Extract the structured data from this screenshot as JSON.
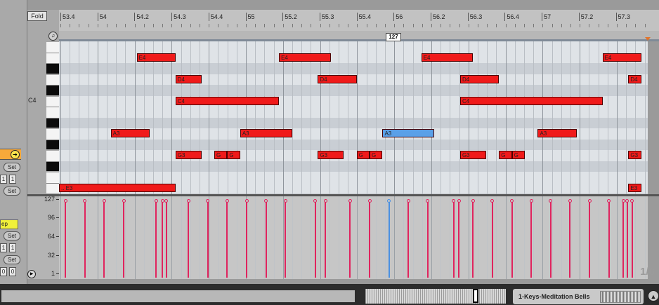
{
  "app": {
    "fold_label": "Fold",
    "key_label": "C4",
    "velocity_badge": "127",
    "zoom": "1/8"
  },
  "left_panel": {
    "set_label": "Set",
    "num_values": [
      "1",
      "1",
      "1",
      "1",
      "0",
      "0"
    ],
    "tag_label": "ep"
  },
  "ruler": {
    "labels": [
      "53.4",
      "54",
      "54.2",
      "54.3",
      "54.4",
      "55",
      "55.2",
      "55.3",
      "55.4",
      "56",
      "56.2",
      "56.3",
      "56.4",
      "57",
      "57.2",
      "57.3"
    ]
  },
  "grid": {
    "lanes_top": [
      "white",
      "white",
      "black",
      "white",
      "black",
      "white",
      "white",
      "black",
      "white",
      "black",
      "white",
      "black",
      "white",
      "white"
    ]
  },
  "notes": [
    {
      "pitch": "E4",
      "row": 1,
      "start": 53.6,
      "end": 53.9,
      "color": "#f01a1a",
      "label": "E4"
    },
    {
      "pitch": "D4",
      "row": 3,
      "start": 53.9,
      "end": 54.1,
      "color": "#f01a1a",
      "label": "D4"
    },
    {
      "pitch": "C4",
      "row": 5,
      "start": 53.9,
      "end": 54.7,
      "color": "#f01a1a",
      "label": "C4"
    },
    {
      "pitch": "A3",
      "row": 8,
      "start": 53.4,
      "end": 53.7,
      "color": "#f01a1a",
      "label": "A3"
    },
    {
      "pitch": "G3",
      "row": 10,
      "start": 53.9,
      "end": 54.1,
      "color": "#f01a1a",
      "label": "G3"
    },
    {
      "pitch": "G3b",
      "row": 10,
      "start": 54.2,
      "end": 54.3,
      "color": "#f01a1a",
      "label": "G"
    },
    {
      "pitch": "G3c",
      "row": 10,
      "start": 54.3,
      "end": 54.4,
      "color": "#f01a1a",
      "label": "G"
    },
    {
      "pitch": "E3",
      "row": 13,
      "start": 53.0,
      "end": 53.9,
      "color": "#f01a1a",
      "label": ".. E3"
    },
    {
      "pitch": "E4",
      "row": 1,
      "start": 54.7,
      "end": 55.1,
      "color": "#f01a1a",
      "label": "E4"
    },
    {
      "pitch": "D4",
      "row": 3,
      "start": 55.0,
      "end": 55.3,
      "color": "#f01a1a",
      "label": "D4"
    },
    {
      "pitch": "A3",
      "row": 8,
      "start": 54.4,
      "end": 54.8,
      "color": "#f01a1a",
      "label": "A3"
    },
    {
      "pitch": "G3",
      "row": 10,
      "start": 55.0,
      "end": 55.2,
      "color": "#f01a1a",
      "label": "G3"
    },
    {
      "pitch": "G3b",
      "row": 10,
      "start": 55.3,
      "end": 55.4,
      "color": "#f01a1a",
      "label": "G"
    },
    {
      "pitch": "G3c",
      "row": 10,
      "start": 55.4,
      "end": 55.5,
      "color": "#f01a1a",
      "label": "G"
    },
    {
      "pitch": "E4",
      "row": 1,
      "start": 55.8,
      "end": 56.2,
      "color": "#f01a1a",
      "label": "E4"
    },
    {
      "pitch": "A3",
      "row": 8,
      "start": 55.5,
      "end": 55.9,
      "color": "#5aa0e8",
      "label": "A3"
    },
    {
      "pitch": "D4",
      "row": 3,
      "start": 56.1,
      "end": 56.4,
      "color": "#f01a1a",
      "label": "D4"
    },
    {
      "pitch": "C4",
      "row": 5,
      "start": 56.1,
      "end": 57.2,
      "color": "#f01a1a",
      "label": "C4"
    },
    {
      "pitch": "G3",
      "row": 10,
      "start": 56.1,
      "end": 56.3,
      "color": "#f01a1a",
      "label": "G3"
    },
    {
      "pitch": "G3b",
      "row": 10,
      "start": 56.4,
      "end": 56.5,
      "color": "#f01a1a",
      "label": "G"
    },
    {
      "pitch": "G3c",
      "row": 10,
      "start": 56.5,
      "end": 56.6,
      "color": "#f01a1a",
      "label": "G"
    },
    {
      "pitch": "A3",
      "row": 8,
      "start": 56.7,
      "end": 57.0,
      "color": "#f01a1a",
      "label": "A3"
    },
    {
      "pitch": "E4",
      "row": 1,
      "start": 57.2,
      "end": 57.5,
      "color": "#f01a1a",
      "label": "E4"
    },
    {
      "pitch": "D4",
      "row": 3,
      "start": 57.4,
      "end": 57.5,
      "color": "#f01a1a",
      "label": "D4"
    },
    {
      "pitch": "G3",
      "row": 10,
      "start": 57.4,
      "end": 57.5,
      "color": "#f01a1a",
      "label": "G3"
    },
    {
      "pitch": "E3",
      "row": 13,
      "start": 57.4,
      "end": 57.5,
      "color": "#f01a1a",
      "label": "E3"
    }
  ],
  "velocity": {
    "scale": [
      "127",
      "96",
      "64",
      "32",
      "1"
    ],
    "stems": [
      {
        "x": 53.05,
        "v": 127,
        "selected": false
      },
      {
        "x": 53.2,
        "v": 127,
        "selected": false
      },
      {
        "x": 53.35,
        "v": 127,
        "selected": false
      },
      {
        "x": 53.5,
        "v": 127,
        "selected": false
      },
      {
        "x": 53.75,
        "v": 127,
        "selected": false
      },
      {
        "x": 53.8,
        "v": 127,
        "selected": false
      },
      {
        "x": 53.83,
        "v": 127,
        "selected": false
      },
      {
        "x": 54.0,
        "v": 127,
        "selected": false
      },
      {
        "x": 54.15,
        "v": 127,
        "selected": false
      },
      {
        "x": 54.3,
        "v": 127,
        "selected": false
      },
      {
        "x": 54.45,
        "v": 127,
        "selected": false
      },
      {
        "x": 54.6,
        "v": 127,
        "selected": false
      },
      {
        "x": 54.75,
        "v": 127,
        "selected": false
      },
      {
        "x": 54.98,
        "v": 127,
        "selected": false
      },
      {
        "x": 55.06,
        "v": 127,
        "selected": false
      },
      {
        "x": 55.25,
        "v": 127,
        "selected": false
      },
      {
        "x": 55.4,
        "v": 127,
        "selected": false
      },
      {
        "x": 55.55,
        "v": 127,
        "selected": true
      },
      {
        "x": 55.7,
        "v": 127,
        "selected": false
      },
      {
        "x": 55.85,
        "v": 127,
        "selected": false
      },
      {
        "x": 56.05,
        "v": 127,
        "selected": false
      },
      {
        "x": 56.09,
        "v": 127,
        "selected": false
      },
      {
        "x": 56.2,
        "v": 127,
        "selected": false
      },
      {
        "x": 56.35,
        "v": 127,
        "selected": false
      },
      {
        "x": 56.5,
        "v": 127,
        "selected": false
      },
      {
        "x": 56.65,
        "v": 127,
        "selected": false
      },
      {
        "x": 56.8,
        "v": 127,
        "selected": false
      },
      {
        "x": 56.95,
        "v": 127,
        "selected": false
      },
      {
        "x": 57.1,
        "v": 127,
        "selected": false
      },
      {
        "x": 57.25,
        "v": 127,
        "selected": false
      },
      {
        "x": 57.36,
        "v": 127,
        "selected": false
      },
      {
        "x": 57.39,
        "v": 127,
        "selected": false
      },
      {
        "x": 57.43,
        "v": 127,
        "selected": false
      }
    ]
  },
  "bottom": {
    "track_name": "1-Keys-Meditation Bells"
  },
  "colors": {
    "note": "#f01a1a",
    "selected_note": "#5aa0e8",
    "velocity": "#e0245e",
    "selected_velocity": "#4a90e2"
  }
}
